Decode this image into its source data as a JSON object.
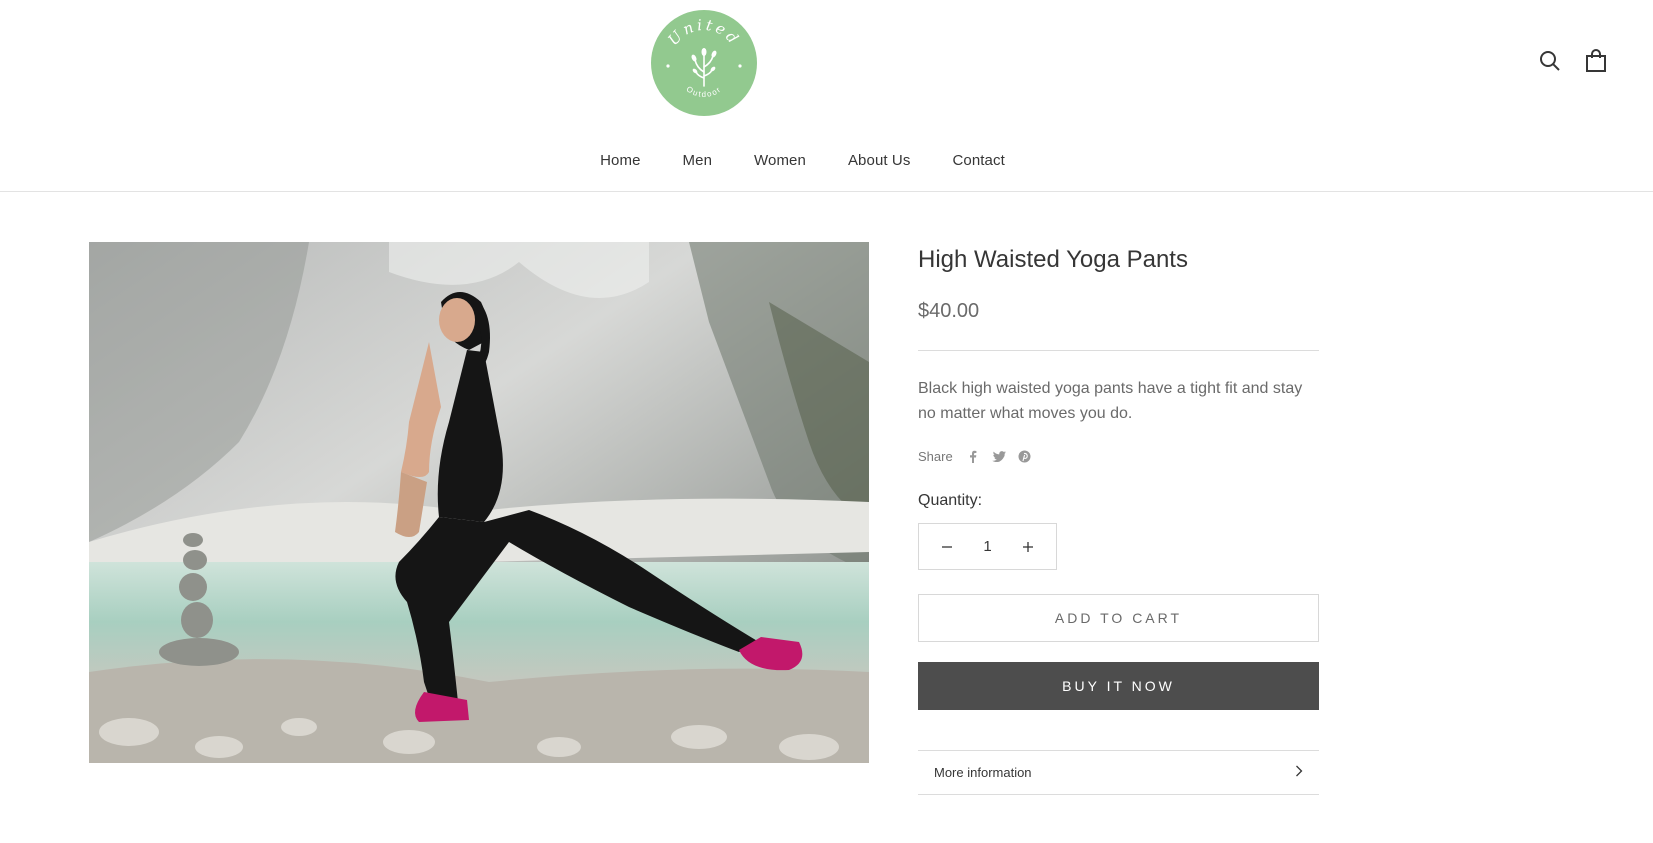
{
  "header": {
    "logo": {
      "text_top": "United",
      "text_bottom": "Outdoor",
      "color": "#92c98f"
    },
    "icons": {
      "search": "search-icon",
      "cart": "cart-bag-icon"
    },
    "nav": [
      {
        "label": "Home"
      },
      {
        "label": "Men"
      },
      {
        "label": "Women"
      },
      {
        "label": "About Us"
      },
      {
        "label": "Contact"
      }
    ]
  },
  "product": {
    "image_icon": "product-photo",
    "title": "High Waisted Yoga Pants",
    "price": "$40.00",
    "description": "Black high waisted yoga pants have a tight fit and stay no matter what moves you do.",
    "share_label": "Share",
    "share_icons": [
      "facebook-icon",
      "twitter-icon",
      "pinterest-icon"
    ],
    "quantity_label": "Quantity:",
    "quantity_value": "1",
    "add_to_cart": "ADD TO CART",
    "buy_now": "BUY IT NOW",
    "more_info": "More information"
  },
  "colors": {
    "text": "#363636",
    "muted": "#6a6a6a",
    "buy_button": "#4d4d4d",
    "border": "#d8d8d8"
  }
}
